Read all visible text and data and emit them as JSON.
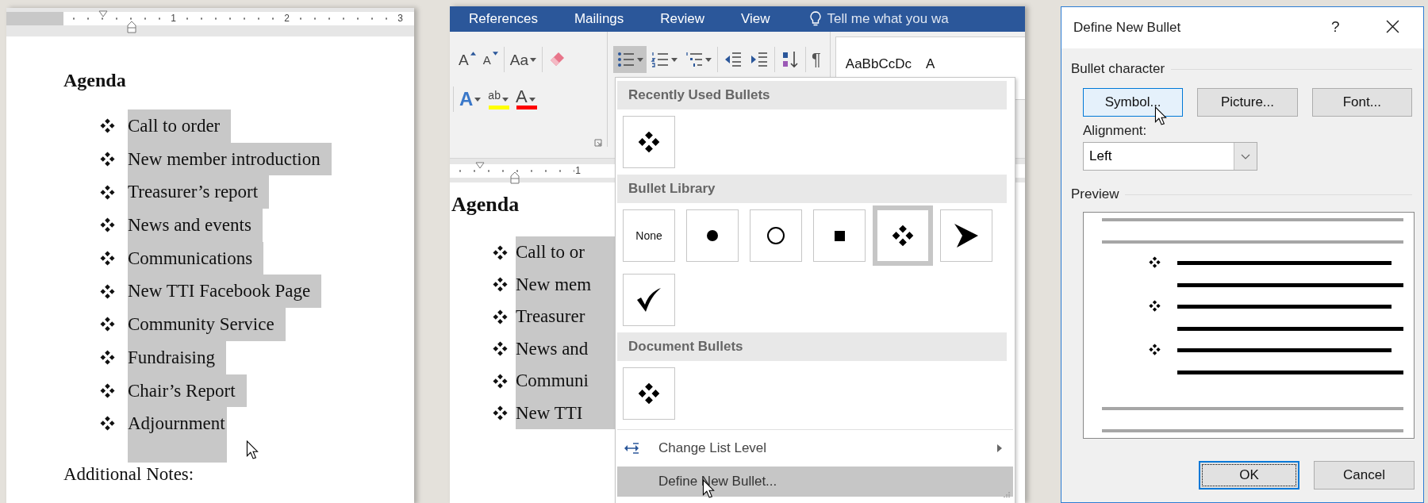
{
  "doc_left": {
    "ruler": {
      "numbers": [
        "1",
        "2",
        "3"
      ]
    },
    "heading": "Agenda",
    "items": [
      "Call to order",
      "New member introduction",
      "Treasurer’s report",
      "News and events",
      "Communications",
      "New TTI Facebook Page",
      "Community Service",
      "Fundraising",
      "Chair’s Report",
      "Adjournment"
    ],
    "footer": "Additional Notes:"
  },
  "word": {
    "tabs": [
      {
        "label": "References",
        "selected": false
      },
      {
        "label": "Mailings",
        "selected": false
      },
      {
        "label": "Review",
        "selected": false
      },
      {
        "label": "View",
        "selected": false
      }
    ],
    "tell_me": "Tell me what you wa",
    "ribbon": {
      "groups": [
        {
          "rows": [
            [
              [
                {
                  "kind": "grow",
                  "label": "A",
                  "on": false,
                  "dropdown": false
                },
                {
                  "kind": "shrink",
                  "label": "A",
                  "on": false,
                  "dropdown": false
                }
              ],
              [
                {
                  "kind": "case",
                  "label": "Aa",
                  "on": false,
                  "dropdown": true
                }
              ],
              [
                {
                  "kind": "clear",
                  "on": false,
                  "dropdown": false
                }
              ]
            ],
            [
              [
                {
                  "kind": "effects",
                  "label": "A",
                  "on": false,
                  "dropdown": true
                },
                {
                  "kind": "highlight",
                  "label": "ab",
                  "on": false,
                  "dropdown": true
                },
                {
                  "kind": "color",
                  "label": "A",
                  "on": false,
                  "dropdown": true
                }
              ]
            ]
          ]
        },
        {
          "rows": [
            [
              [
                {
                  "kind": "bullets",
                  "on": true,
                  "dropdown": true
                },
                {
                  "kind": "numbering",
                  "on": false,
                  "dropdown": true
                },
                {
                  "kind": "multilevel",
                  "on": false,
                  "dropdown": true
                }
              ],
              [
                {
                  "kind": "outdent",
                  "on": false,
                  "dropdown": false
                },
                {
                  "kind": "indent",
                  "on": false,
                  "dropdown": false
                }
              ],
              [
                {
                  "kind": "sort",
                  "on": false,
                  "dropdown": false
                }
              ],
              [
                {
                  "kind": "marks",
                  "label": "¶",
                  "on": false,
                  "dropdown": false
                }
              ]
            ]
          ]
        }
      ],
      "styles": [
        "AaBbCcDc",
        "A"
      ]
    },
    "ruler": {
      "numbers": [
        "1"
      ]
    },
    "heading": "Agenda",
    "items": [
      "Call to or",
      "New mem",
      "Treasurer",
      "News and",
      "Communi",
      "New TTI"
    ],
    "menu": {
      "sections": [
        {
          "title": "Recently Used Bullets",
          "tiles": [
            {
              "kind": "diamond",
              "selected": false
            }
          ]
        },
        {
          "title": "Bullet Library",
          "tiles": [
            {
              "kind": "none",
              "label": "None",
              "selected": false
            },
            {
              "kind": "dot",
              "selected": false
            },
            {
              "kind": "circle",
              "selected": false
            },
            {
              "kind": "square",
              "selected": false
            },
            {
              "kind": "diamond",
              "selected": true
            },
            {
              "kind": "arrow",
              "selected": false
            },
            {
              "kind": "check",
              "selected": false
            }
          ]
        },
        {
          "title": "Document Bullets",
          "tiles": [
            {
              "kind": "diamond",
              "selected": false
            }
          ]
        }
      ],
      "items": [
        {
          "kind": "submenu",
          "label": "Change List Level",
          "selected": false
        },
        {
          "kind": "plain",
          "label": "Define New Bullet...",
          "selected": true
        }
      ]
    }
  },
  "dialog": {
    "title": "Define New Bullet",
    "help": "?",
    "group_title": "Bullet character",
    "char_buttons": [
      {
        "label": "Symbol...",
        "hovered": true
      },
      {
        "label": "Picture...",
        "hovered": false
      },
      {
        "label": "Font...",
        "hovered": false
      }
    ],
    "alignment_label": "Alignment:",
    "alignment_value": "Left",
    "preview_title": "Preview",
    "buttons": [
      {
        "label": "OK",
        "default": true
      },
      {
        "label": "Cancel",
        "default": false
      }
    ]
  }
}
